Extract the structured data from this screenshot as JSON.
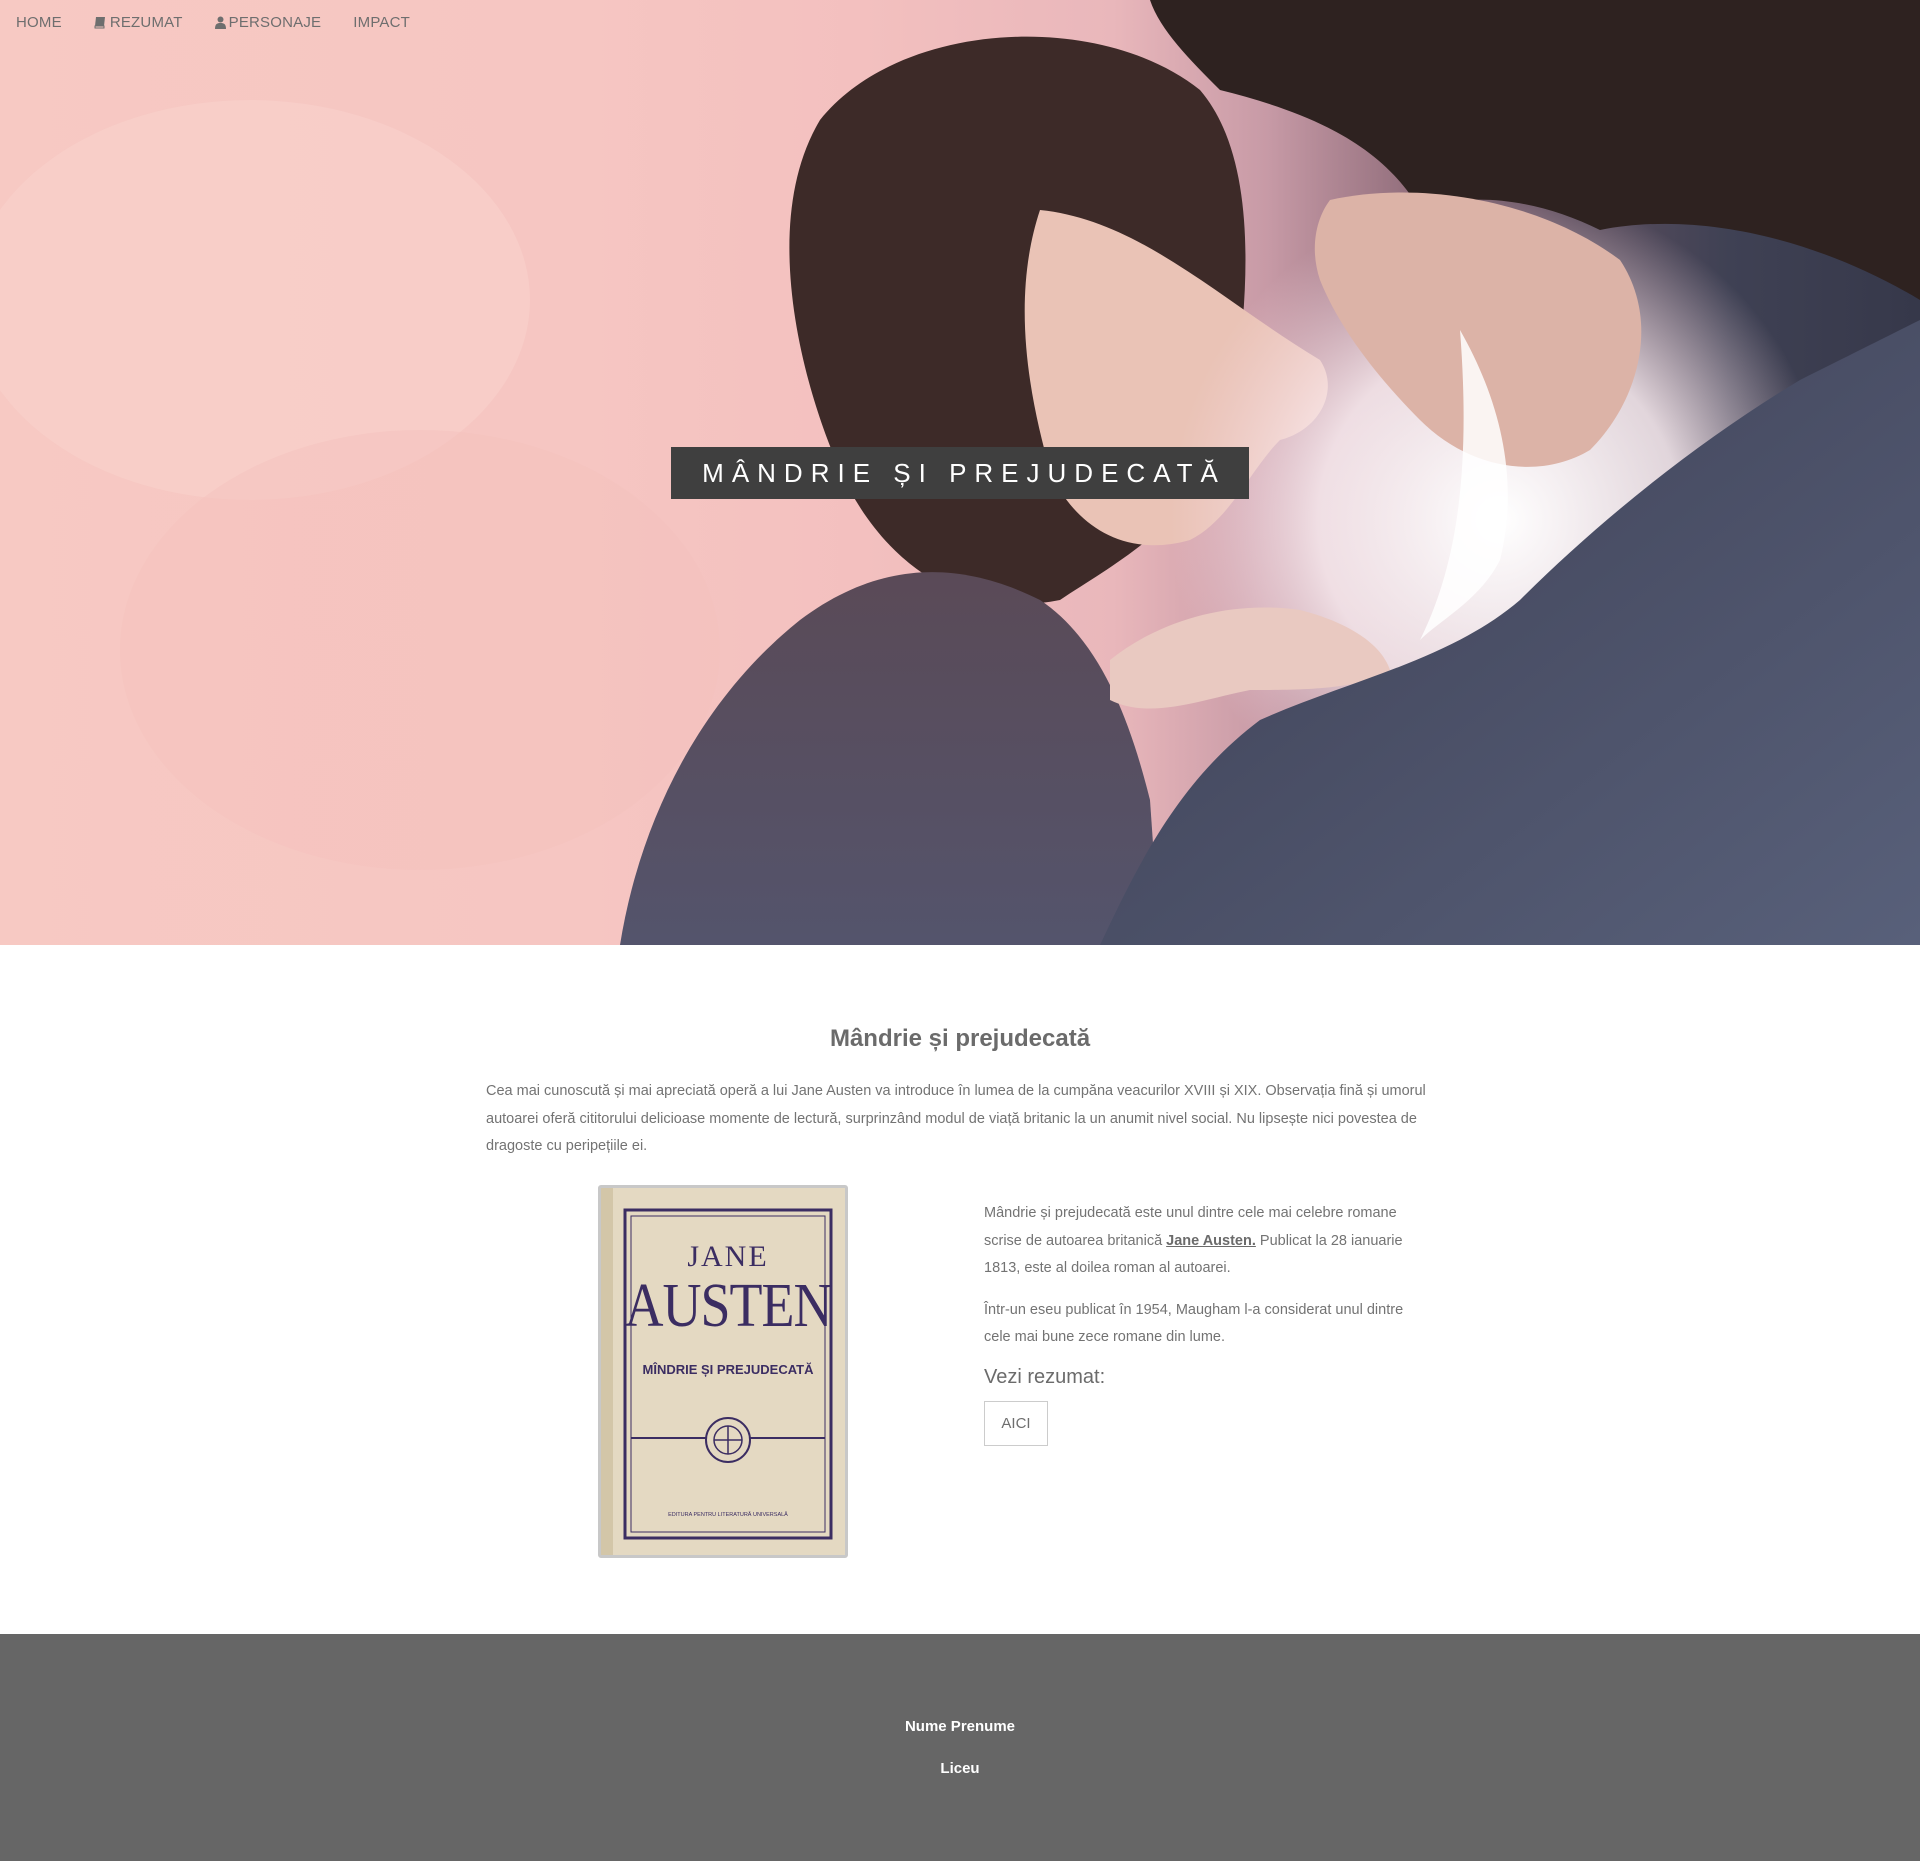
{
  "nav": {
    "items": [
      {
        "label": "HOME",
        "icon": ""
      },
      {
        "label": "REZUMAT",
        "icon": "book-icon"
      },
      {
        "label": "PERSONAJE",
        "icon": "user-icon"
      },
      {
        "label": "IMPACT",
        "icon": ""
      }
    ]
  },
  "hero": {
    "title": "MÂNDRIE ȘI PREJUDECATĂ"
  },
  "main": {
    "title": "Mândrie și prejudecată",
    "intro": "Cea mai cunoscută și mai apreciată operă a lui Jane Austen va introduce în lumea de la cumpăna veacurilor XVIII și XIX. Observația fină și umorul autoarei oferă cititorului delicioase momente de lectură, surprinzând modul de viață britanic la un anumit nivel social. Nu lipsește nici povestea de dragoste cu peripețiile ei.",
    "book_cover": {
      "line1": "JANE",
      "line2": "AUSTEN",
      "line3": "MÎNDRIE ȘI PREJUDECATĂ",
      "publisher": "EDITURA PENTRU LITERATURĂ UNIVERSALĂ"
    },
    "para1_before": "Mândrie și prejudecată este unul dintre cele mai celebre romane scrise de autoarea britanică ",
    "para1_link": "Jane Austen.",
    "para1_after": " Publicat la 28 ianuarie 1813, este al doilea roman al autoarei.",
    "para2": "Într-un eseu publicat în 1954, Maugham l-a considerat unul dintre cele mai bune zece romane din lume.",
    "vezi_label": "Vezi rezumat:",
    "button_label": "AICI"
  },
  "footer": {
    "name": "Nume Prenume",
    "school": "Liceu"
  },
  "colors": {
    "hero_pink": "#f7c9c3",
    "title_box": "#3f3f3f",
    "footer_bg": "#666666",
    "text": "#737373"
  }
}
